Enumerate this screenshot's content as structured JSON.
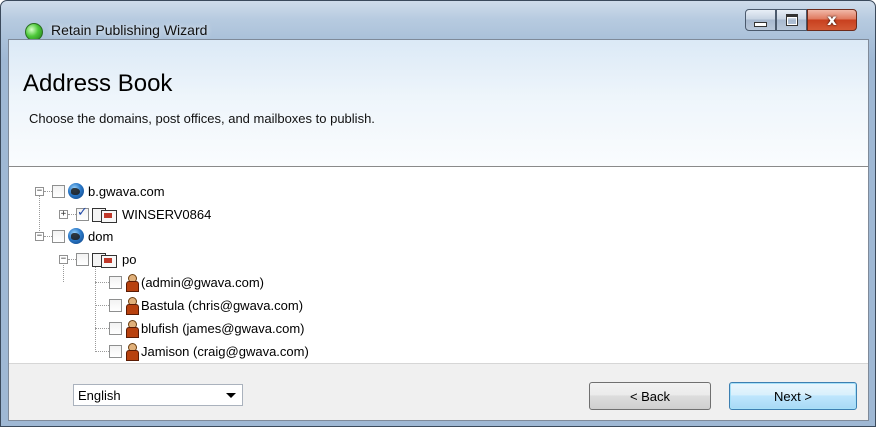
{
  "window": {
    "title": "Retain Publishing Wizard",
    "close_glyph": "x"
  },
  "header": {
    "title": "Address Book",
    "description": "Choose the domains, post offices, and mailboxes to publish."
  },
  "tree": {
    "nodes": [
      {
        "label": "b.gwava.com",
        "type": "domain",
        "checked": false,
        "expander": "−"
      },
      {
        "label": "WINSERV0864",
        "type": "post-office",
        "checked": true,
        "expander": "+"
      },
      {
        "label": "dom",
        "type": "domain",
        "checked": false,
        "expander": "−"
      },
      {
        "label": "po",
        "type": "post-office",
        "checked": false,
        "expander": "−"
      },
      {
        "label": "(admin@gwava.com)",
        "type": "mailbox",
        "checked": false
      },
      {
        "label": "Bastula (chris@gwava.com)",
        "type": "mailbox",
        "checked": false
      },
      {
        "label": "blufish (james@gwava.com)",
        "type": "mailbox",
        "checked": false
      },
      {
        "label": "Jamison (craig@gwava.com)",
        "type": "mailbox",
        "checked": false
      }
    ]
  },
  "footer": {
    "language": "English",
    "back_label": "< Back",
    "next_label": "Next >"
  },
  "colors": {
    "title_orb": "#4ec93a",
    "close_button": "#c8401f",
    "next_button_border": "#3c7fb1"
  }
}
